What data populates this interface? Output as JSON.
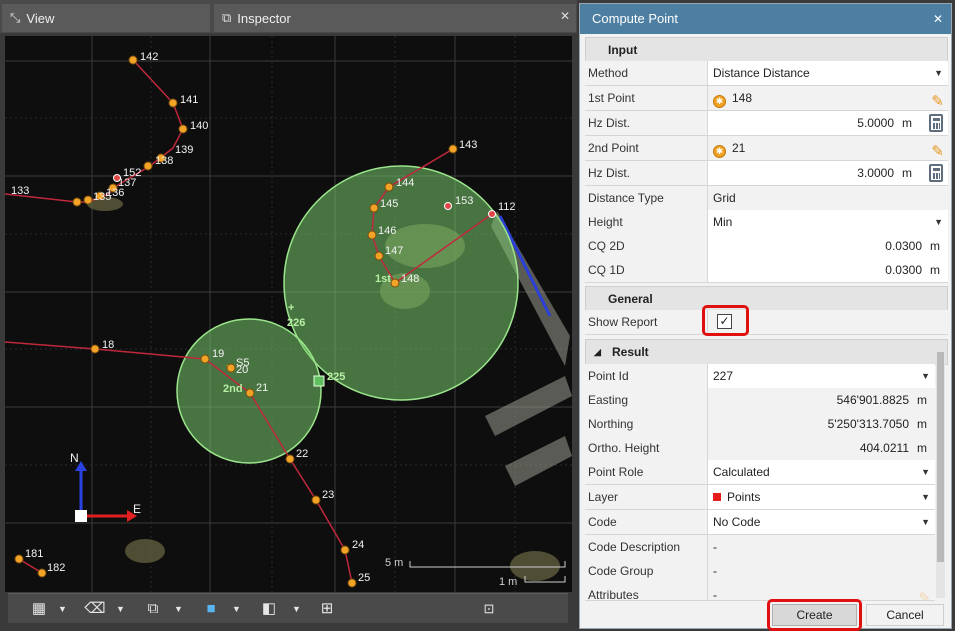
{
  "tabs": {
    "view": "View",
    "inspector": "Inspector"
  },
  "map": {
    "points": [
      {
        "id": "142"
      },
      {
        "id": "141"
      },
      {
        "id": "140"
      },
      {
        "id": "139"
      },
      {
        "id": "138"
      },
      {
        "id": "152"
      },
      {
        "id": "137"
      },
      {
        "id": "136"
      },
      {
        "id": "135"
      },
      {
        "id": "133"
      },
      {
        "id": "143"
      },
      {
        "id": "144"
      },
      {
        "id": "145"
      },
      {
        "id": "146"
      },
      {
        "id": "147"
      },
      {
        "id": "148"
      },
      {
        "id": "153"
      },
      {
        "id": "112"
      },
      {
        "id": "18"
      },
      {
        "id": "19"
      },
      {
        "id": "S5"
      },
      {
        "id": "20"
      },
      {
        "id": "21"
      },
      {
        "id": "22"
      },
      {
        "id": "23"
      },
      {
        "id": "24"
      },
      {
        "id": "25"
      },
      {
        "id": "181"
      },
      {
        "id": "182"
      }
    ],
    "markers": {
      "first": "1st",
      "second": "2nd",
      "p226": "226",
      "p225": "225"
    },
    "compass": {
      "north": "N",
      "east": "E"
    },
    "scale": {
      "big": "5 m",
      "small": "1 m"
    }
  },
  "panel": {
    "title": "Compute Point",
    "input": {
      "header": "Input",
      "method": {
        "label": "Method",
        "value": "Distance Distance"
      },
      "first_point": {
        "label": "1st Point",
        "value": "148"
      },
      "hz_dist_1": {
        "label": "Hz Dist.",
        "value": "5.0000",
        "unit": "m"
      },
      "second_point": {
        "label": "2nd Point",
        "value": "21"
      },
      "hz_dist_2": {
        "label": "Hz Dist.",
        "value": "3.0000",
        "unit": "m"
      },
      "distance_type": {
        "label": "Distance Type",
        "value": "Grid"
      },
      "height": {
        "label": "Height",
        "value": "Min"
      },
      "cq2d": {
        "label": "CQ 2D",
        "value": "0.0300",
        "unit": "m"
      },
      "cq1d": {
        "label": "CQ 1D",
        "value": "0.0300",
        "unit": "m"
      }
    },
    "general": {
      "header": "General",
      "show_report": {
        "label": "Show Report",
        "checked": "✓"
      }
    },
    "result": {
      "header": "Result",
      "point_id": {
        "label": "Point Id",
        "value": "227"
      },
      "easting": {
        "label": "Easting",
        "value": "546'901.8825",
        "unit": "m"
      },
      "northing": {
        "label": "Northing",
        "value": "5'250'313.7050",
        "unit": "m"
      },
      "ortho": {
        "label": "Ortho. Height",
        "value": "404.0211",
        "unit": "m"
      },
      "point_role": {
        "label": "Point Role",
        "value": "Calculated"
      },
      "layer": {
        "label": "Layer",
        "value": "Points"
      },
      "code": {
        "label": "Code",
        "value": "No Code"
      },
      "code_desc": {
        "label": "Code Description",
        "value": "-"
      },
      "code_group": {
        "label": "Code Group",
        "value": "-"
      },
      "attributes": {
        "label": "Attributes",
        "value": "-"
      }
    },
    "buttons": {
      "create": "Create",
      "cancel": "Cancel"
    }
  }
}
